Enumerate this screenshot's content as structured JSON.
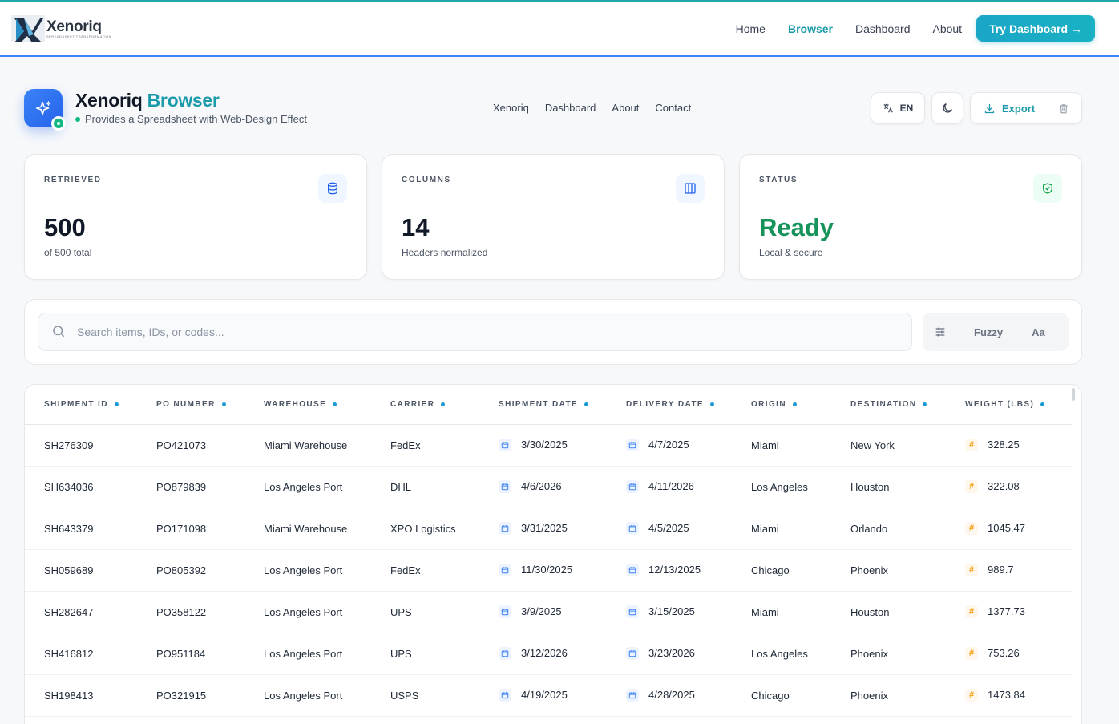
{
  "brand": {
    "name": "Xenoriq",
    "tagline": "SPREADSHEET TRANSFORMATION"
  },
  "topnav": {
    "items": [
      {
        "label": "Home",
        "active": false
      },
      {
        "label": "Browser",
        "active": true
      },
      {
        "label": "Dashboard",
        "active": false
      },
      {
        "label": "About",
        "active": false
      }
    ],
    "cta": "Try Dashboard →"
  },
  "header": {
    "title_main": "Xenoriq",
    "title_accent": "Browser",
    "subtitle": "Provides a Spreadsheet with Web-Design Effect",
    "subnav": [
      "Xenoriq",
      "Dashboard",
      "About",
      "Contact"
    ],
    "lang": "EN",
    "export_label": "Export"
  },
  "stats": [
    {
      "label": "RETRIEVED",
      "value": "500",
      "note": "of 500 total",
      "icon": "database-icon"
    },
    {
      "label": "COLUMNS",
      "value": "14",
      "note": "Headers normalized",
      "icon": "columns-icon"
    },
    {
      "label": "STATUS",
      "value": "Ready",
      "note": "Local & secure",
      "icon": "shield-check-icon"
    }
  ],
  "search": {
    "placeholder": "Search items, IDs, or codes...",
    "value": "",
    "fuzzy_label": "Fuzzy",
    "case_label": "Aa"
  },
  "table": {
    "columns": [
      "SHIPMENT ID",
      "PO NUMBER",
      "WAREHOUSE",
      "CARRIER",
      "SHIPMENT DATE",
      "DELIVERY DATE",
      "ORIGIN",
      "DESTINATION",
      "WEIGHT (LBS)"
    ],
    "rows": [
      [
        "SH276309",
        "PO421073",
        "Miami Warehouse",
        "FedEx",
        "3/30/2025",
        "4/7/2025",
        "Miami",
        "New York",
        "328.25"
      ],
      [
        "SH634036",
        "PO879839",
        "Los Angeles Port",
        "DHL",
        "4/6/2026",
        "4/11/2026",
        "Los Angeles",
        "Houston",
        "322.08"
      ],
      [
        "SH643379",
        "PO171098",
        "Miami Warehouse",
        "XPO Logistics",
        "3/31/2025",
        "4/5/2025",
        "Miami",
        "Orlando",
        "1045.47"
      ],
      [
        "SH059689",
        "PO805392",
        "Los Angeles Port",
        "FedEx",
        "11/30/2025",
        "12/13/2025",
        "Chicago",
        "Phoenix",
        "989.7"
      ],
      [
        "SH282647",
        "PO358122",
        "Los Angeles Port",
        "UPS",
        "3/9/2025",
        "3/15/2025",
        "Miami",
        "Houston",
        "1377.73"
      ],
      [
        "SH416812",
        "PO951184",
        "Los Angeles Port",
        "UPS",
        "3/12/2026",
        "3/23/2026",
        "Los Angeles",
        "Phoenix",
        "753.26"
      ],
      [
        "SH198413",
        "PO321915",
        "Los Angeles Port",
        "USPS",
        "4/19/2025",
        "4/28/2025",
        "Chicago",
        "Phoenix",
        "1473.84"
      ]
    ]
  }
}
